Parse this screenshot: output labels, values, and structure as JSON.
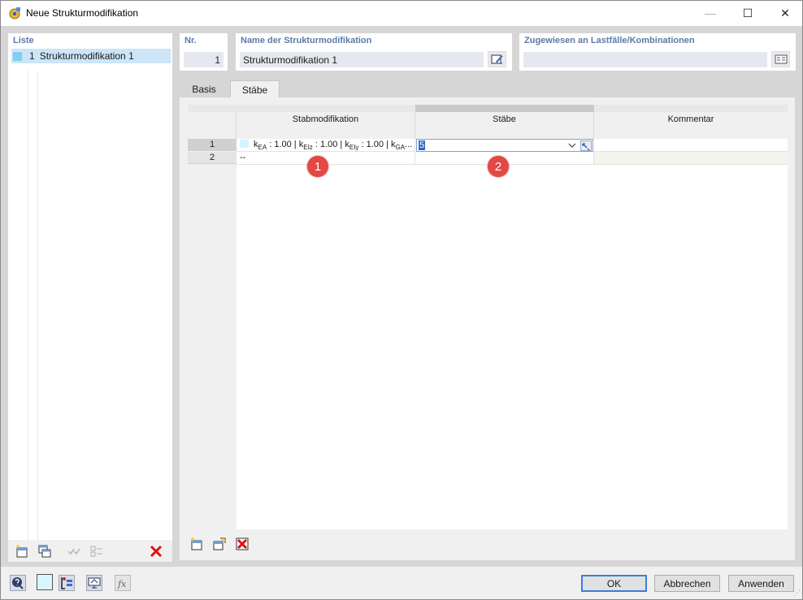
{
  "window": {
    "title": "Neue Strukturmodifikation",
    "min_glyph": "—",
    "max_glyph": "☐",
    "close_glyph": "✕"
  },
  "list": {
    "title": "Liste",
    "items": [
      {
        "num": "1",
        "label": "Strukturmodifikation 1",
        "color": "#7fd0f2"
      }
    ]
  },
  "header": {
    "nr_title": "Nr.",
    "nr_value": "1",
    "name_title": "Name der Strukturmodifikation",
    "name_value": "Strukturmodifikation 1",
    "assigned_title": "Zugewiesen an Lastfälle/Kombinationen",
    "assigned_value": ""
  },
  "tabs": [
    {
      "label": "Basis"
    },
    {
      "label": "Stäbe"
    }
  ],
  "grid": {
    "columns": [
      "Stabmodifikation",
      "Stäbe",
      "Kommentar"
    ],
    "rows": [
      {
        "num": "1",
        "modification": {
          "kEA": "k",
          "kEA_sub": "EA",
          "kEA_val": " : 1.00 | k",
          "kEIz_sub": "EIz",
          "kEIz_val": " : 1.00 | k",
          "kEIy_sub": "EIy",
          "kEIy_val": " : 1.00 | k",
          "kGA_sub": "GA",
          "tail": "..."
        },
        "staebe": "5",
        "kommentar": ""
      },
      {
        "num": "2",
        "modification_text": "--",
        "staebe": "",
        "kommentar": ""
      }
    ],
    "markers": [
      "1",
      "2"
    ]
  },
  "footer": {
    "ok": "OK",
    "cancel": "Abbrechen",
    "apply": "Anwenden"
  },
  "colors": {
    "accent": "#5b7ba6",
    "marker": "#e24844",
    "selection": "#cce5f8"
  }
}
